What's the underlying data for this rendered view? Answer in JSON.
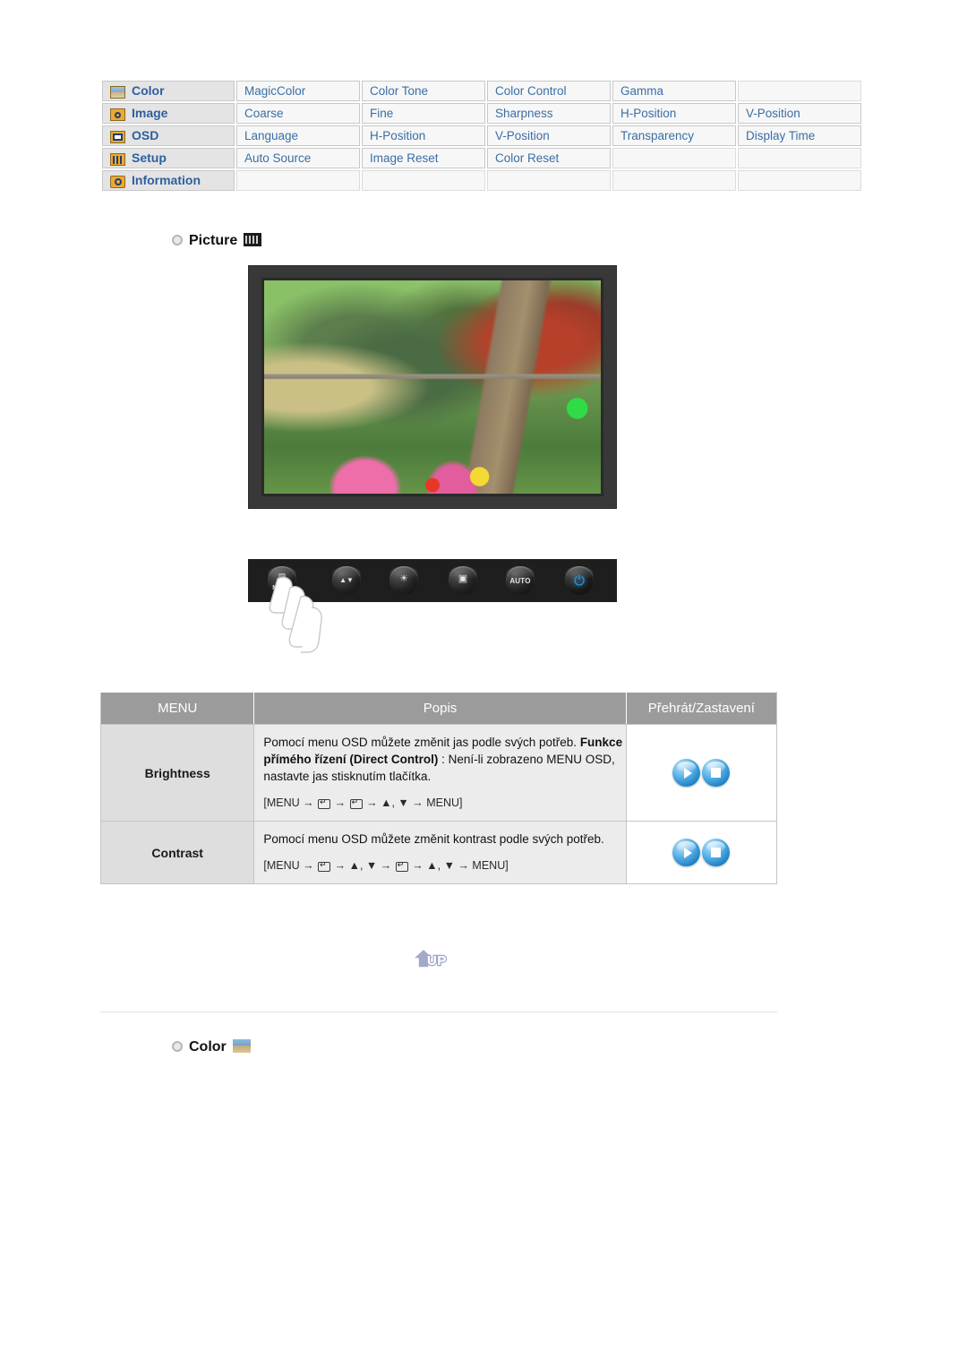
{
  "nav_table": {
    "rows": [
      {
        "category": "Color",
        "icon": "color-swatch-icon",
        "items": [
          "MagicColor",
          "Color Tone",
          "Color Control",
          "Gamma",
          ""
        ]
      },
      {
        "category": "Image",
        "icon": "image-icon",
        "items": [
          "Coarse",
          "Fine",
          "Sharpness",
          "H-Position",
          "V-Position"
        ]
      },
      {
        "category": "OSD",
        "icon": "osd-icon",
        "items": [
          "Language",
          "H-Position",
          "V-Position",
          "Transparency",
          "Display Time"
        ]
      },
      {
        "category": "Setup",
        "icon": "setup-icon",
        "items": [
          "Auto Source",
          "Image Reset",
          "Color Reset",
          "",
          ""
        ]
      },
      {
        "category": "Information",
        "icon": "information-icon",
        "items": [
          "",
          "",
          "",
          "",
          ""
        ]
      }
    ]
  },
  "sections": {
    "picture_heading": "Picture",
    "color_heading": "Color"
  },
  "monitor": {
    "alt": "Monitor displaying a garden photo with a stone pagoda, trees and paper lanterns"
  },
  "button_bar": {
    "buttons": [
      {
        "name": "menu-button",
        "label": "MENU",
        "glyph": "▤"
      },
      {
        "name": "adjust-button",
        "label": "",
        "glyph": "▲▼"
      },
      {
        "name": "brightness-button",
        "label": "",
        "glyph": "☀"
      },
      {
        "name": "enter-source-button",
        "label": "",
        "glyph": "▣"
      },
      {
        "name": "auto-button",
        "label": "AUTO",
        "glyph": ""
      },
      {
        "name": "power-button",
        "label": "",
        "glyph": "⏻"
      }
    ]
  },
  "desc_table": {
    "headers": [
      "MENU",
      "Popis",
      "Přehrát/Zastavení"
    ],
    "rows": [
      {
        "menu": "Brightness",
        "desc_line1": "Pomocí menu OSD můžete změnit jas podle svých potřeb.",
        "desc_bold": "Funkce přímého řízení (Direct Control)",
        "desc_line2": " : Není-li zobrazeno MENU OSD, nastavte jas stisknutím tlačítka.",
        "sequence_prefix": "[MENU",
        "sequence_parts": [
          "→",
          "KEY",
          "→",
          "KEY",
          "→",
          "▲, ▼",
          "→",
          "MENU]"
        ],
        "play_label": "play",
        "stop_label": "stop"
      },
      {
        "menu": "Contrast",
        "desc_line1": "Pomocí menu OSD můžete změnit kontrast podle svých potřeb.",
        "desc_bold": "",
        "desc_line2": "",
        "sequence_prefix": "[MENU",
        "sequence_parts": [
          "→",
          "KEY",
          "→",
          "▲, ▼",
          "→",
          "KEY",
          "→",
          "▲, ▼",
          "→",
          "MENU]"
        ],
        "play_label": "play",
        "stop_label": "stop"
      }
    ]
  },
  "up_button": {
    "label": "UP"
  },
  "colors": {
    "link_blue": "#3a6ea5",
    "category_blue": "#2f5f9e",
    "header_gray": "#9b9b9b",
    "cell_gray": "#ececec",
    "menu_cell_gray": "#dedede",
    "icon_orange": "#f0a830",
    "power_blue": "#1e9ef0"
  }
}
